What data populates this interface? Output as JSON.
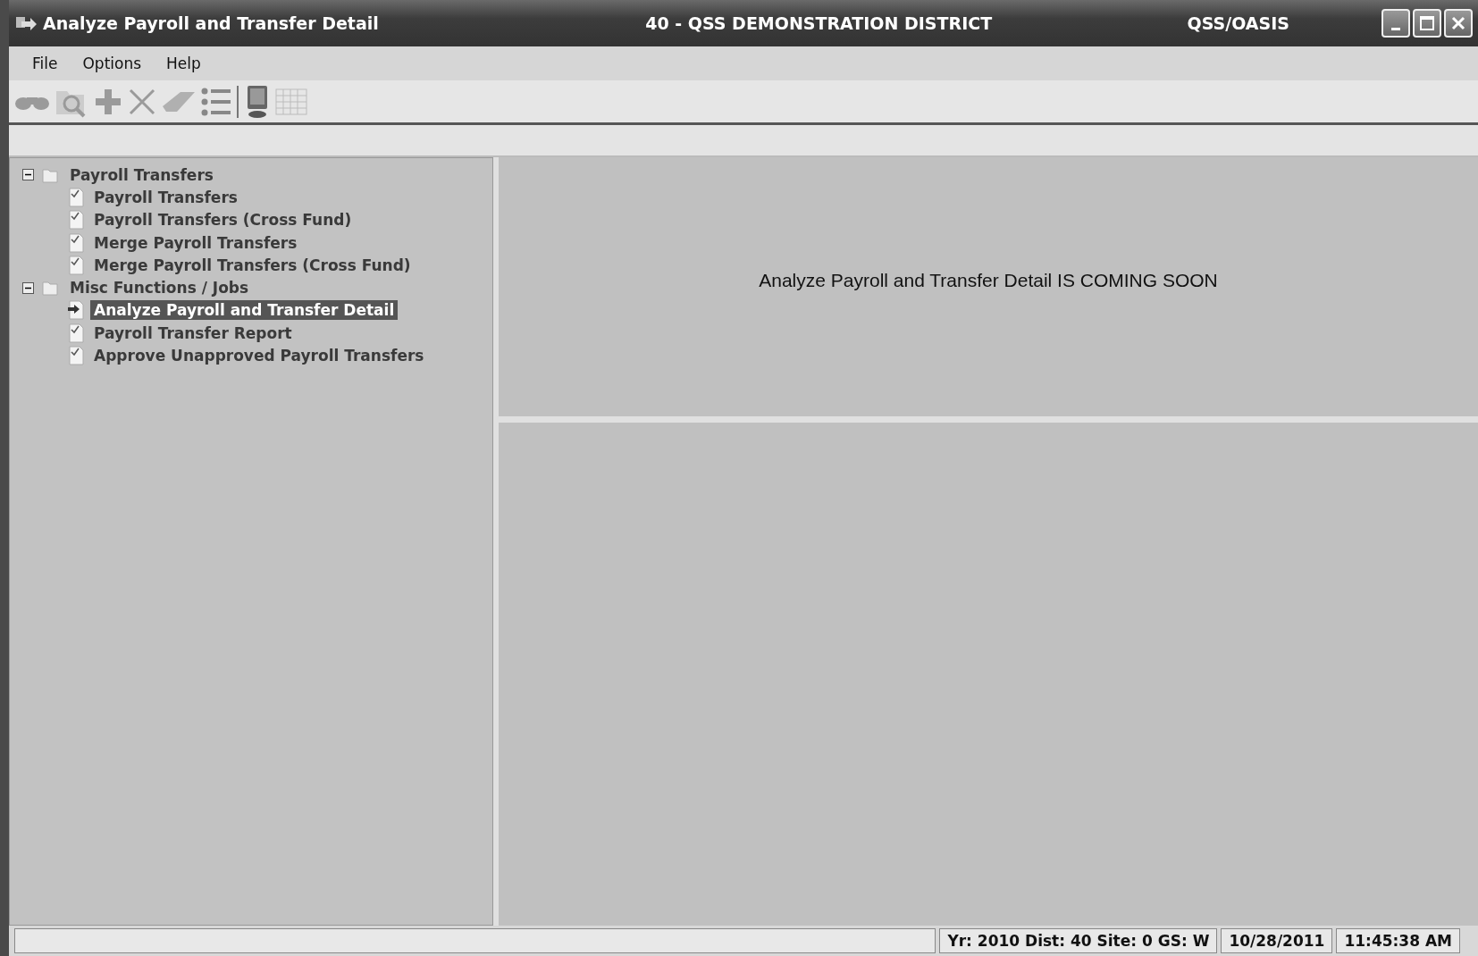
{
  "window": {
    "title": "Analyze Payroll and Transfer Detail",
    "center_title": "40 - QSS DEMONSTRATION DISTRICT",
    "right_title": "QSS/OASIS"
  },
  "menu": [
    "File",
    "Options",
    "Help"
  ],
  "toolbar": [
    {
      "kind": "binoculars"
    },
    {
      "kind": "folder-search"
    },
    {
      "kind": "plus"
    },
    {
      "kind": "cross"
    },
    {
      "kind": "eraser"
    },
    {
      "kind": "list"
    },
    {
      "kind": "separator"
    },
    {
      "kind": "monitor"
    },
    {
      "kind": "grid"
    }
  ],
  "tree": [
    {
      "label": "Payroll Transfers",
      "expanded": true,
      "children": [
        {
          "label": "Payroll Transfers",
          "selected": false
        },
        {
          "label": "Payroll Transfers (Cross Fund)",
          "selected": false
        },
        {
          "label": "Merge Payroll Transfers",
          "selected": false
        },
        {
          "label": "Merge Payroll Transfers (Cross Fund)",
          "selected": false
        }
      ]
    },
    {
      "label": "Misc Functions / Jobs",
      "expanded": true,
      "children": [
        {
          "label": "Analyze Payroll and Transfer Detail",
          "selected": true
        },
        {
          "label": "Payroll Transfer Report",
          "selected": false
        },
        {
          "label": "Approve Unapproved Payroll Transfers",
          "selected": false
        }
      ]
    }
  ],
  "message": "Analyze Payroll and Transfer Detail IS COMING SOON",
  "status_bar": [
    "Yr: 2010 Dist: 40 Site: 0 GS: W",
    "10/28/2011",
    "11:45:38 AM"
  ]
}
